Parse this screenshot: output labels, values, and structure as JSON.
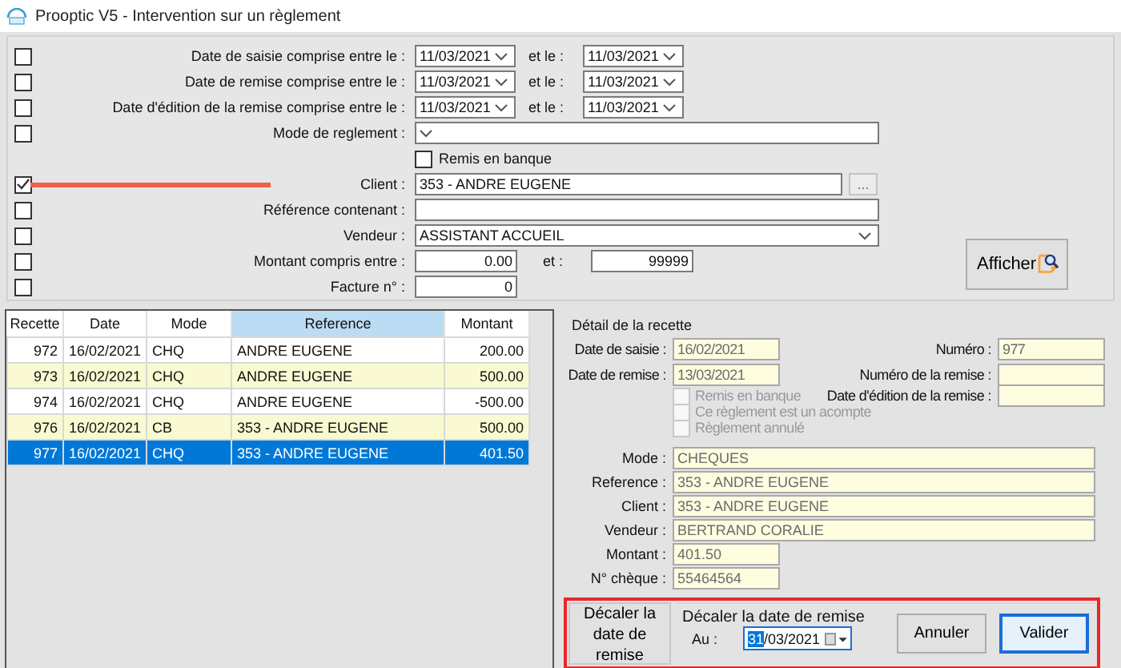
{
  "window": {
    "title": "Prooptic V5 - Intervention sur un règlement"
  },
  "filters": [
    {
      "kind": "date_range",
      "checked": false,
      "label": "Date de saisie comprise entre le :",
      "from": "11/03/2021",
      "connector": "et le :",
      "to": "11/03/2021"
    },
    {
      "kind": "date_range",
      "checked": false,
      "label": "Date de remise comprise entre le :",
      "from": "11/03/2021",
      "connector": "et le :",
      "to": "11/03/2021"
    },
    {
      "kind": "date_range",
      "checked": false,
      "label": "Date d'édition de la remise comprise entre le :",
      "from": "11/03/2021",
      "connector": "et le :",
      "to": "11/03/2021"
    },
    {
      "kind": "select",
      "checked": false,
      "label": "Mode de reglement :"
    },
    {
      "kind": "option",
      "checked": false,
      "label": "Remis en banque"
    },
    {
      "kind": "lookup",
      "checked": true,
      "label": "Client :",
      "value": "353 - ANDRE EUGENE",
      "button": "..."
    },
    {
      "kind": "text",
      "checked": false,
      "label": "Référence contenant :"
    },
    {
      "kind": "select",
      "checked": false,
      "label": "Vendeur :",
      "value": "ASSISTANT ACCUEIL"
    },
    {
      "kind": "range",
      "checked": false,
      "label": "Montant compris entre :",
      "from": "0.00",
      "connector": "et :",
      "to": "99999"
    },
    {
      "kind": "number",
      "checked": false,
      "label": "Facture n° :",
      "value": "0"
    }
  ],
  "show_button": {
    "label": "Afficher"
  },
  "table": {
    "columns": [
      {
        "label": "Recette",
        "sorted": false
      },
      {
        "label": "Date",
        "sorted": false
      },
      {
        "label": "Mode",
        "sorted": false
      },
      {
        "label": "Reference",
        "sorted": true
      },
      {
        "label": "Montant",
        "sorted": false
      }
    ],
    "rows": [
      {
        "cells": [
          "972",
          "16/02/2021",
          "CHQ",
          "ANDRE EUGENE",
          "200.00"
        ],
        "selected": false
      },
      {
        "cells": [
          "973",
          "16/02/2021",
          "CHQ",
          "ANDRE EUGENE",
          "500.00"
        ],
        "selected": false
      },
      {
        "cells": [
          "974",
          "16/02/2021",
          "CHQ",
          "ANDRE EUGENE",
          "-500.00"
        ],
        "selected": false
      },
      {
        "cells": [
          "976",
          "16/02/2021",
          "CB",
          "353 - ANDRE EUGENE",
          "500.00"
        ],
        "selected": false
      },
      {
        "cells": [
          "977",
          "16/02/2021",
          "CHQ",
          "353 - ANDRE EUGENE",
          "401.50"
        ],
        "selected": true
      }
    ]
  },
  "detail": {
    "title": "Détail de la recette",
    "left_fields": [
      {
        "label": "Date de saisie :",
        "value": "16/02/2021"
      },
      {
        "label": "Date de remise :",
        "value": "13/03/2021"
      }
    ],
    "right_fields": [
      {
        "label": "Numéro :",
        "value": "977"
      },
      {
        "label": "Numéro de la remise :"
      },
      {
        "label": "Date d'édition de la remise :"
      }
    ],
    "options": [
      {
        "label": "Remis en banque",
        "checked": false,
        "disabled": true
      },
      {
        "label": "Ce règlement est un acompte",
        "checked": false,
        "disabled": true
      },
      {
        "label": "Règlement annulé",
        "checked": false,
        "disabled": true
      }
    ],
    "fields": [
      {
        "label": "Mode :",
        "value": "CHEQUES",
        "kind": "long"
      },
      {
        "label": "Reference :",
        "value": "353 - ANDRE EUGENE",
        "kind": "long"
      },
      {
        "label": "Client :",
        "value": "353 - ANDRE EUGENE",
        "kind": "long"
      },
      {
        "label": "Vendeur :",
        "value": "BERTRAND CORALIE",
        "kind": "long"
      },
      {
        "label": "Montant :",
        "value": "401.50",
        "kind": "short"
      },
      {
        "label": "N° chèque :",
        "value": "55464564",
        "kind": "short"
      }
    ]
  },
  "postpone": {
    "button": "Décaler la date de remise",
    "group_title": "Décaler la date de remise",
    "date_label": "Au :",
    "date": "31/03/2021",
    "day_selected": true,
    "buttons": [
      {
        "label": "Annuler",
        "default": false
      },
      {
        "label": "Valider",
        "default": true
      }
    ]
  }
}
